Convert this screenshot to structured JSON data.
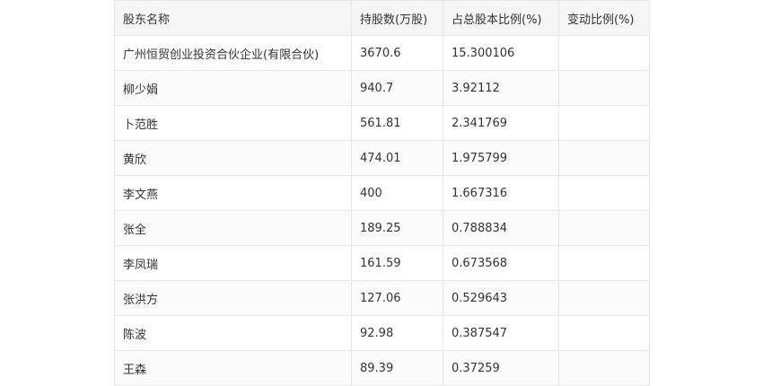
{
  "table": {
    "headers": [
      "股东名称",
      "持股数(万股)",
      "占总股本比例(%)",
      "变动比例(%)"
    ],
    "rows": [
      [
        "广州恒贸创业投资合伙企业(有限合伙)",
        "3670.6",
        "15.300106",
        ""
      ],
      [
        "柳少娟",
        "940.7",
        "3.92112",
        ""
      ],
      [
        "卜范胜",
        "561.81",
        "2.341769",
        ""
      ],
      [
        "黄欣",
        "474.01",
        "1.975799",
        ""
      ],
      [
        "李文燕",
        "400",
        "1.667316",
        ""
      ],
      [
        "张全",
        "189.25",
        "0.788834",
        ""
      ],
      [
        "李凤瑞",
        "161.59",
        "0.673568",
        ""
      ],
      [
        "张洪方",
        "127.06",
        "0.529643",
        ""
      ],
      [
        "陈波",
        "92.98",
        "0.387547",
        ""
      ],
      [
        "王森",
        "89.39",
        "0.37259",
        ""
      ]
    ]
  }
}
